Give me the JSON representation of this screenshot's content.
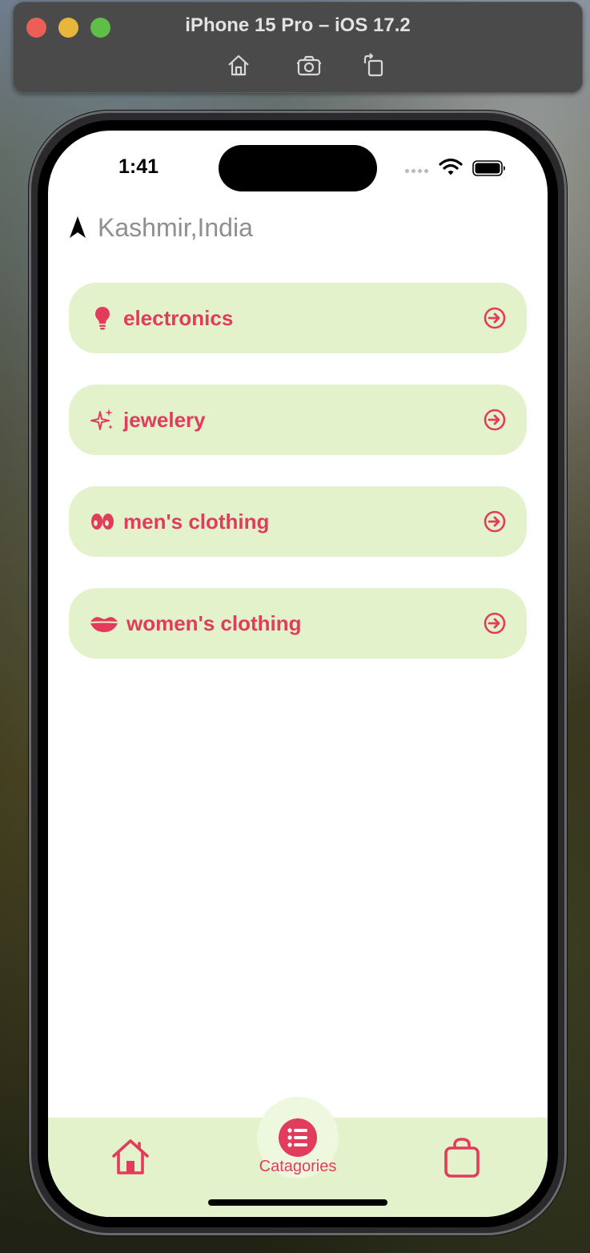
{
  "simulator": {
    "title": "iPhone 15 Pro – iOS 17.2",
    "tools": [
      "home-icon",
      "screenshot-icon",
      "rotate-icon"
    ]
  },
  "status_bar": {
    "time": "1:41"
  },
  "location": {
    "icon": "location-arrow-icon",
    "text": "Kashmir,India"
  },
  "categories": [
    {
      "label": "electronics",
      "icon": "lightbulb-icon"
    },
    {
      "label": "jewelery",
      "icon": "sparkles-icon"
    },
    {
      "label": "men's clothing",
      "icon": "eyes-icon"
    },
    {
      "label": "women's clothing",
      "icon": "lips-icon"
    }
  ],
  "tab_bar": {
    "home_icon": "house-icon",
    "categories_label": "Catagories",
    "bag_icon": "bag-icon"
  },
  "colors": {
    "accent": "#e23c5c",
    "card_background": "#e4f2cc"
  }
}
